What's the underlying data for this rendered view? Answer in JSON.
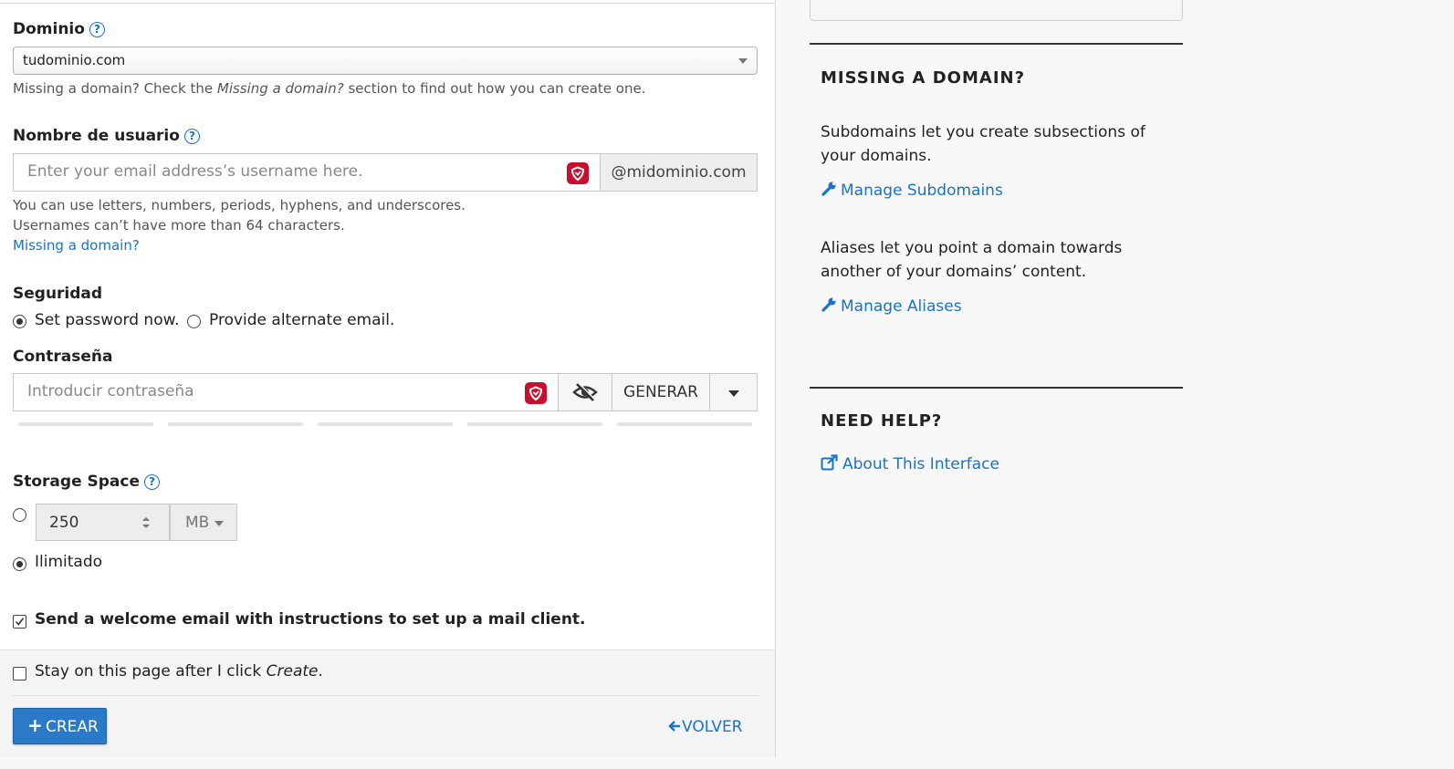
{
  "form": {
    "domain": {
      "label": "Dominio",
      "value": "tudominio.com",
      "hint_pre": "Missing a domain? Check the ",
      "hint_em": "Missing a domain?",
      "hint_post": " section to find out how you can create one."
    },
    "username": {
      "label": "Nombre de usuario",
      "placeholder": "Enter your email address’s username here.",
      "suffix": "@midominio.com",
      "hint1": "You can use letters, numbers, periods, hyphens, and underscores.",
      "hint2": "Usernames can’t have more than 64 characters.",
      "missing_link": "Missing a domain?"
    },
    "security": {
      "label": "Seguridad",
      "option_set": "Set password now.",
      "option_alt": "Provide alternate email.",
      "selected": "set"
    },
    "password": {
      "label": "Contraseña",
      "placeholder": "Introducir contraseña",
      "generate_label": "GENERAR",
      "strength_segments": 5
    },
    "storage": {
      "label": "Storage Space",
      "value": "250",
      "unit": "MB",
      "unlimited_label": "Ilimitado",
      "selected": "unlimited"
    },
    "welcome": {
      "label": "Send a welcome email with instructions to set up a mail client.",
      "checked": true
    },
    "stay": {
      "label_pre": "Stay on this page after I click ",
      "label_em": "Create",
      "label_post": ".",
      "checked": false
    },
    "create_label": "CREAR",
    "back_label": "VOLVER"
  },
  "sidebar": {
    "missing": {
      "heading": "MISSING A DOMAIN?",
      "subdomains_text": "Subdomains let you create subsections of your domains.",
      "subdomains_link": "Manage Subdomains",
      "aliases_text": "Aliases let you point a domain towards another of your domains’ content.",
      "aliases_link": "Manage Aliases"
    },
    "help": {
      "heading": "NEED HELP?",
      "link": "About This Interface"
    }
  },
  "colors": {
    "accent": "#1a73c9",
    "primary_button": "#2a7ac8",
    "password_manager_icon": "#c8102e"
  },
  "icons": [
    "help-icon",
    "chevron-down-icon",
    "password-manager-icon",
    "eye-slash-icon",
    "caret-down-icon",
    "spinner-arrows-icon",
    "checkmark-icon",
    "plus-icon",
    "arrow-left-icon",
    "wrench-icon",
    "external-link-icon"
  ]
}
